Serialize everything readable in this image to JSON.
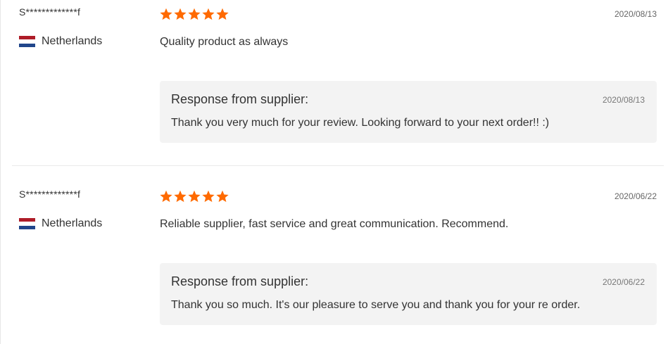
{
  "reviews": [
    {
      "user": "S*************f",
      "country": "Netherlands",
      "rating": 5,
      "date": "2020/08/13",
      "comment": "Quality product as always",
      "response": {
        "title": "Response from supplier:",
        "date": "2020/08/13",
        "text": "Thank you very much for your review. Looking forward to your next order!! :)"
      }
    },
    {
      "user": "S*************f",
      "country": "Netherlands",
      "rating": 5,
      "date": "2020/06/22",
      "comment": "Reliable supplier, fast service and great communication. Recommend.",
      "response": {
        "title": "Response from supplier:",
        "date": "2020/06/22",
        "text": "Thank you so much. It's our pleasure to serve you and thank you for your re order."
      }
    }
  ],
  "colors": {
    "star": "#ff6a00",
    "response_bg": "#f3f3f3"
  },
  "icons": {
    "star": "star-icon",
    "flag": "netherlands-flag-icon"
  }
}
